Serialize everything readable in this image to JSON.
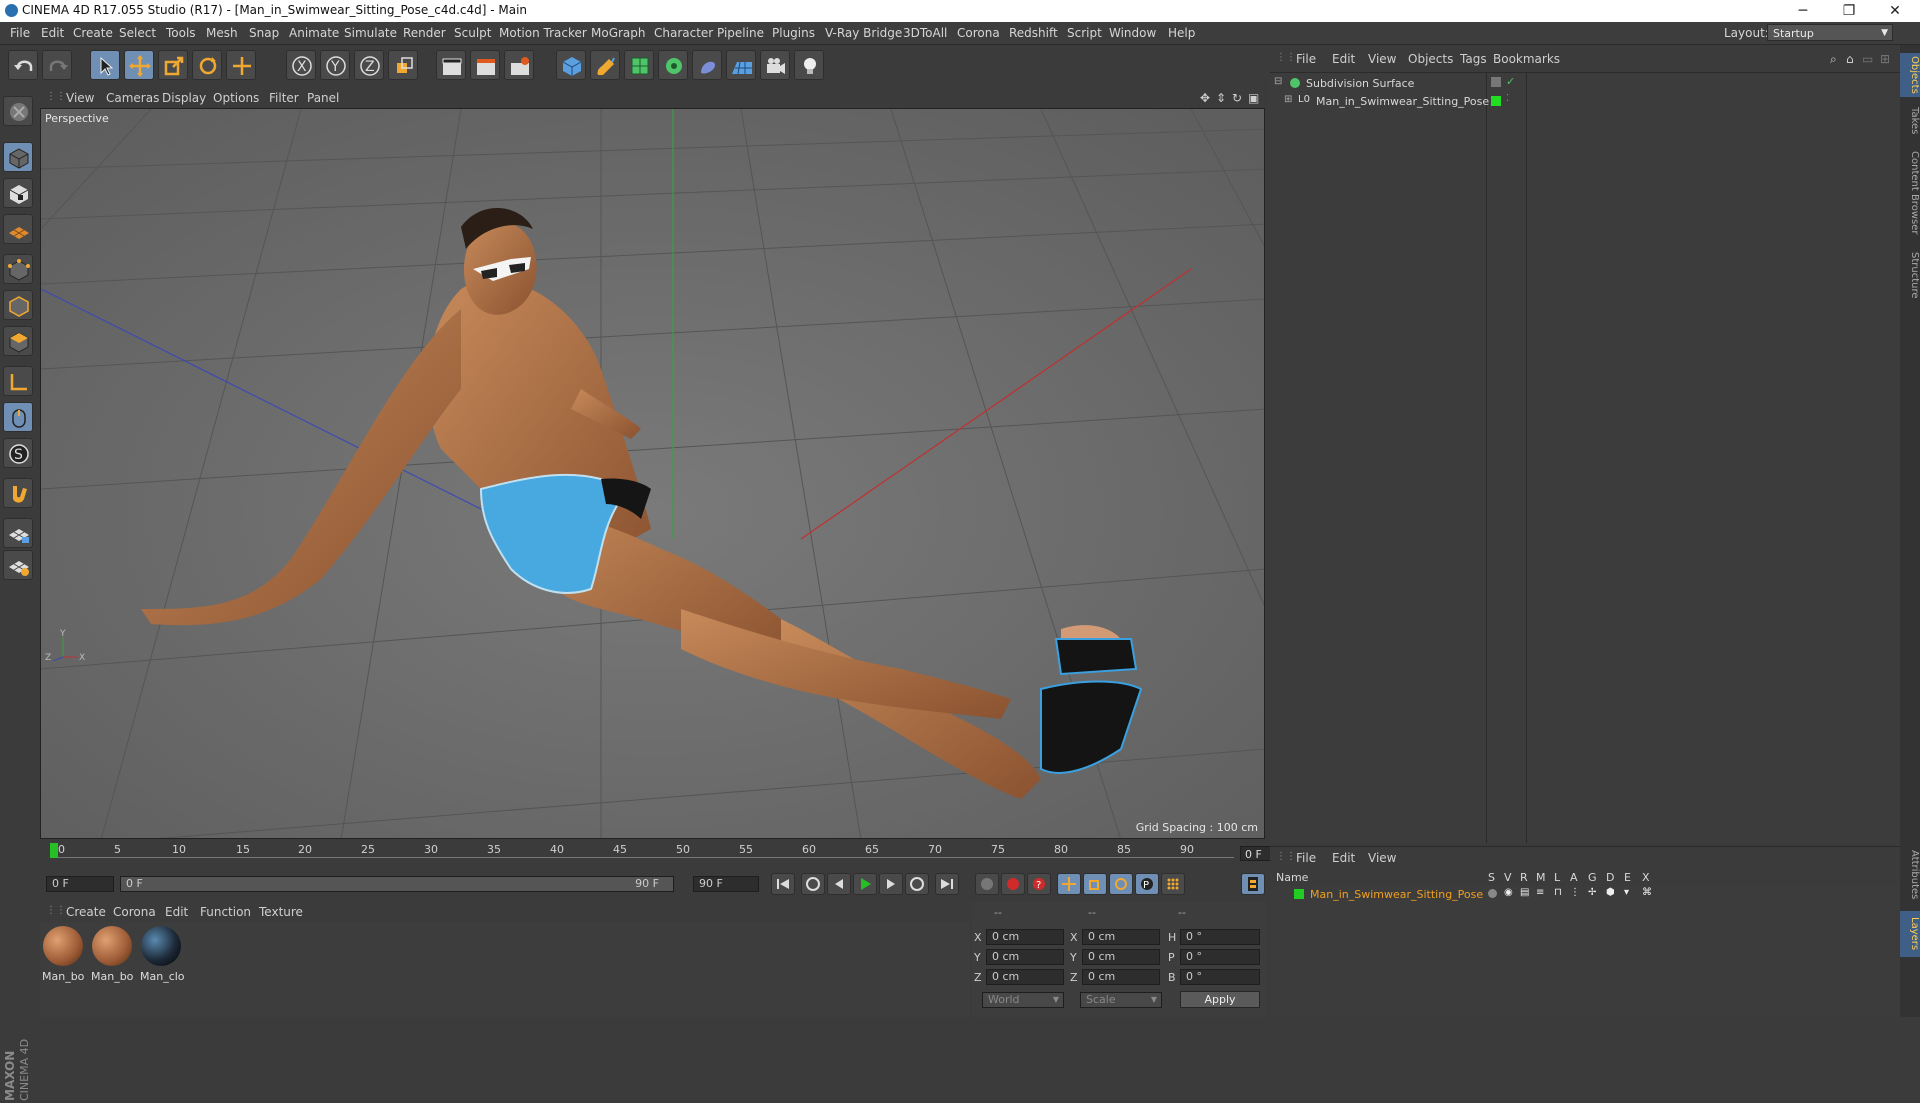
{
  "window": {
    "title": "CINEMA 4D R17.055 Studio (R17) - [Man_in_Swimwear_Sitting_Pose_c4d.c4d] - Main",
    "minimize": "─",
    "maximize": "❐",
    "close": "✕"
  },
  "menubar": {
    "items": [
      "File",
      "Edit",
      "Create",
      "Select",
      "Tools",
      "Mesh",
      "Snap",
      "Animate",
      "Simulate",
      "Render",
      "Sculpt",
      "Motion Tracker",
      "MoGraph",
      "Character",
      "Pipeline",
      "Plugins",
      "V-Ray Bridge",
      "3DToAll",
      "Corona",
      "Redshift",
      "Script",
      "Window",
      "Help"
    ],
    "layout_label": "Layout:",
    "layout_value": "Startup"
  },
  "viewport": {
    "menu": [
      "View",
      "Cameras",
      "Display",
      "Options",
      "Filter",
      "Panel"
    ],
    "label": "Perspective",
    "grid_spacing": "Grid Spacing : 100 cm",
    "axis_y": "Y",
    "axis_z": "Z",
    "axis_x": "X"
  },
  "timeline": {
    "ticks": [
      "0",
      "5",
      "10",
      "15",
      "20",
      "25",
      "30",
      "35",
      "40",
      "45",
      "50",
      "55",
      "60",
      "65",
      "70",
      "75",
      "80",
      "85",
      "90"
    ],
    "current_frame": "0 F",
    "start_field": "0 F",
    "range_start": "0 F",
    "range_end": "90 F",
    "end_field": "90 F"
  },
  "materials": {
    "menu": [
      "Create",
      "Corona",
      "Edit",
      "Function",
      "Texture"
    ],
    "items": [
      {
        "label": "Man_bo",
        "color": "#9b5a35"
      },
      {
        "label": "Man_bo",
        "color": "#9b5a35"
      },
      {
        "label": "Man_clo",
        "color": "#1d2a38"
      }
    ]
  },
  "coords": {
    "headers": [
      "--",
      "--",
      "--"
    ],
    "rows": [
      {
        "a1": "X",
        "v1": "0 cm",
        "a2": "X",
        "v2": "0 cm",
        "a3": "H",
        "v3": "0 °"
      },
      {
        "a1": "Y",
        "v1": "0 cm",
        "a2": "Y",
        "v2": "0 cm",
        "a3": "P",
        "v3": "0 °"
      },
      {
        "a1": "Z",
        "v1": "0 cm",
        "a2": "Z",
        "v2": "0 cm",
        "a3": "B",
        "v3": "0 °"
      }
    ],
    "world": "World",
    "scale": "Scale",
    "apply": "Apply"
  },
  "object_manager": {
    "menu": [
      "File",
      "Edit",
      "View",
      "Objects",
      "Tags",
      "Bookmarks"
    ],
    "objects": [
      {
        "name": "Subdivision Surface",
        "icon_color": "#4fc56a"
      },
      {
        "name": "Man_in_Swimwear_Sitting_Pose",
        "tag_color": "#22dd22"
      }
    ]
  },
  "right_tabs": [
    "Objects",
    "Takes",
    "Content Browser",
    "Structure",
    "Attributes",
    "Layers"
  ],
  "layer_manager": {
    "menu": [
      "File",
      "Edit",
      "View"
    ],
    "columns": [
      "Name",
      "S",
      "V",
      "R",
      "M",
      "L",
      "A",
      "G",
      "D",
      "E",
      "X"
    ],
    "layers": [
      {
        "name": "Man_in_Swimwear_Sitting_Pose",
        "color": "#22cc22"
      }
    ]
  },
  "colors": {
    "accent": "#6f8fb4",
    "layer_text": "#f0a020",
    "highlight_orange": "#e8a23a"
  }
}
